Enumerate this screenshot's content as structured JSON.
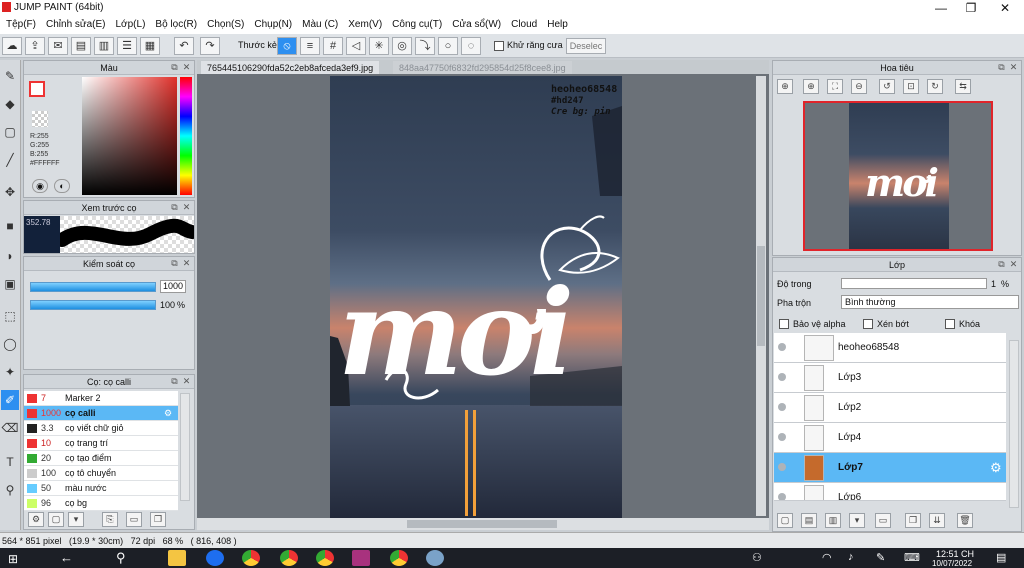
{
  "window": {
    "title": "JUMP PAINT (64bit)",
    "min": "—",
    "max": "❐",
    "close": "✕"
  },
  "menu": [
    "Tệp(F)",
    "Chỉnh sửa(E)",
    "Lớp(L)",
    "Bộ lọc(R)",
    "Chọn(S)",
    "Chụp(N)",
    "Màu (C)",
    "Xem(V)",
    "Công cụ(T)",
    "Cửa sổ(W)",
    "Cloud",
    "Help"
  ],
  "toolbar": {
    "ruler_label": "Thước kẻ",
    "antialias_label": "Khử răng cưa",
    "deselect_label": "Deselec"
  },
  "color_panel": {
    "title": "Màu",
    "r": "R:255",
    "g": "G:255",
    "b": "B:255",
    "hex": "#FFFFFF"
  },
  "brush_preview": {
    "title": "Xem trước cọ",
    "size": "352.78"
  },
  "brush_control": {
    "title": "Kiểm soát cọ",
    "size_value": "1000",
    "opacity_value": "100",
    "opacity_unit": "%"
  },
  "brush_list": {
    "title": "Cọ: cọ calli",
    "items": [
      {
        "size": "7",
        "name": "Marker 2",
        "color": "#e33"
      },
      {
        "size": "1000",
        "name": "cọ calli",
        "color": "#e33",
        "selected": true
      },
      {
        "size": "3.3",
        "name": "cọ viết chữ giỏ",
        "color": "#222"
      },
      {
        "size": "10",
        "name": "cọ trang trí",
        "color": "#e33"
      },
      {
        "size": "20",
        "name": "cọ tạo điểm",
        "color": "#3a3"
      },
      {
        "size": "100",
        "name": "cọ tô chuyển",
        "color": "#ccc"
      },
      {
        "size": "50",
        "name": "màu nước",
        "color": "#6cf"
      },
      {
        "size": "96",
        "name": "cọ bg",
        "color": "#cf6"
      }
    ]
  },
  "tabs": [
    "765445106290fda52c2eb8afceda3ef9.jpg",
    "848aa47750f6832fd295854d25f8cee8.jpg"
  ],
  "canvas": {
    "watermark": [
      "heoheo68548",
      "#hd247",
      "Cre bg: pin"
    ],
    "lettering": "mơi"
  },
  "navigator": {
    "title": "Hoa tiêu",
    "lettering": "mơi"
  },
  "layer_panel": {
    "title": "Lớp",
    "opacity_label": "Độ trong",
    "opacity_value": "1",
    "opacity_unit": "%",
    "blend_label": "Pha trộn",
    "blend_value": "Bình thường",
    "protect_alpha": "Bảo vệ alpha",
    "clipping": "Xén bớt",
    "lock": "Khóa",
    "layers": [
      {
        "name": "heoheo68548",
        "selected": false
      },
      {
        "name": "Lớp3",
        "selected": false
      },
      {
        "name": "Lớp2",
        "selected": false
      },
      {
        "name": "Lớp4",
        "selected": false
      },
      {
        "name": "Lớp7",
        "selected": true
      },
      {
        "name": "Lớp6",
        "selected": false
      }
    ]
  },
  "status": {
    "text": "564 * 851 pixel   (19.9 * 30cm)   72 dpi   68 %   ( 816, 408 )"
  },
  "taskbar": {
    "time": "12:51 CH",
    "date": "10/07/2022"
  },
  "colors": {
    "accent": "#2d8ff0",
    "selection": "#5bb8f5",
    "nav_frame": "#e0242a"
  }
}
